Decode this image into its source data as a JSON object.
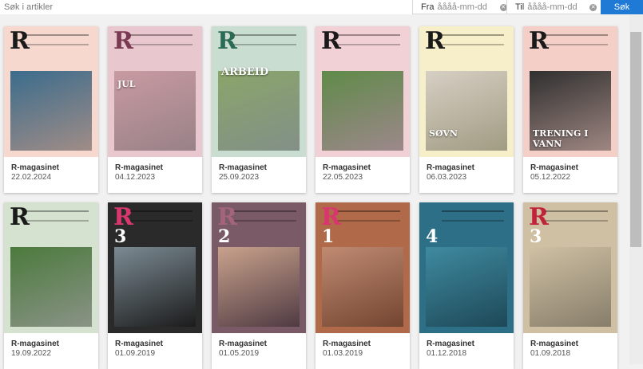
{
  "search": {
    "placeholder": "Søk i artikler"
  },
  "date_from": {
    "label": "Fra",
    "placeholder": "åååå-mm-dd"
  },
  "date_to": {
    "label": "Til",
    "placeholder": "åååå-mm-dd"
  },
  "search_button": "Søk",
  "magazines": [
    {
      "title": "R-magasinet",
      "date": "22.02.2024",
      "cover_text": "",
      "cover_bg": "#f6d8cf",
      "photo": "#3b6c8c",
      "mast_color": "#1a1a1a"
    },
    {
      "title": "R-magasinet",
      "date": "04.12.2023",
      "cover_text": "JUL",
      "cover_bg": "#e9c7cf",
      "photo": "#c99aa2",
      "mast_color": "#7a3a52"
    },
    {
      "title": "R-magasinet",
      "date": "25.09.2023",
      "cover_text": "ARBEID",
      "cover_bg": "#c9ddd0",
      "photo": "#8aa56a",
      "mast_color": "#2b6a55"
    },
    {
      "title": "R-magasinet",
      "date": "22.05.2023",
      "cover_text": "",
      "cover_bg": "#f1d0d6",
      "photo": "#5f8a48",
      "mast_color": "#1a1a1a"
    },
    {
      "title": "R-magasinet",
      "date": "06.03.2023",
      "cover_text": "SØVN",
      "cover_bg": "#f7efc9",
      "photo": "#d6cfc4",
      "mast_color": "#1a1a1a"
    },
    {
      "title": "R-magasinet",
      "date": "05.12.2022",
      "cover_text": "TRENING I VANN",
      "cover_bg": "#f4cfc8",
      "photo": "#2f2f2f",
      "mast_color": "#1a1a1a"
    },
    {
      "title": "R-magasinet",
      "date": "19.09.2022",
      "cover_text": "",
      "cover_bg": "#d4e2cf",
      "photo": "#4b7a3c",
      "mast_color": "#1a1a1a"
    },
    {
      "title": "R-magasinet",
      "date": "01.09.2019",
      "cover_text": "",
      "cover_bg": "#2a2a2a",
      "photo": "#7b8a93",
      "mast_color": "#d8376e",
      "issue": "3"
    },
    {
      "title": "R-magasinet",
      "date": "01.05.2019",
      "cover_text": "",
      "cover_bg": "#7a5a66",
      "photo": "#c9a28c",
      "mast_color": "#a3647c",
      "issue": "2"
    },
    {
      "title": "R-magasinet",
      "date": "01.03.2019",
      "cover_text": "",
      "cover_bg": "#b06a4a",
      "photo": "#c08a72",
      "mast_color": "#d8376e",
      "issue": "1"
    },
    {
      "title": "R-magasinet",
      "date": "01.12.2018",
      "cover_text": "",
      "cover_bg": "#2d6f86",
      "photo": "#3f8aa0",
      "mast_color": "#2d6f86",
      "issue": "4"
    },
    {
      "title": "R-magasinet",
      "date": "01.09.2018",
      "cover_text": "",
      "cover_bg": "#cfc0a3",
      "photo": "#cfc0a3",
      "mast_color": "#c0243a",
      "issue": "3"
    }
  ]
}
